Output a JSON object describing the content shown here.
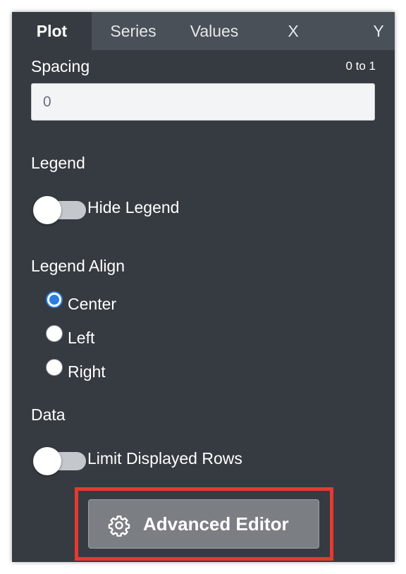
{
  "tabs": [
    {
      "label": "Plot",
      "active": true
    },
    {
      "label": "Series",
      "active": false
    },
    {
      "label": "Values",
      "active": false
    },
    {
      "label": "X",
      "active": false
    },
    {
      "label": "Y",
      "active": false
    }
  ],
  "spacing": {
    "label": "Spacing",
    "range_hint": "0 to 1",
    "value": "0"
  },
  "legend": {
    "section_label": "Legend",
    "toggle_label": "Hide Legend",
    "toggle_on": false
  },
  "legend_align": {
    "section_label": "Legend Align",
    "options": [
      {
        "label": "Center",
        "checked": true
      },
      {
        "label": "Left",
        "checked": false
      },
      {
        "label": "Right",
        "checked": false
      }
    ]
  },
  "data": {
    "section_label": "Data",
    "toggle_label": "Limit Displayed Rows",
    "toggle_on": false
  },
  "advanced_editor": {
    "label": "Advanced Editor",
    "icon": "gear-icon"
  },
  "colors": {
    "panel_bg": "#363b41",
    "tab_bar_bg": "#4a5058",
    "radio_accent": "#2a7de1",
    "highlight_border": "#e53a2f",
    "button_bg": "#7b7f83"
  }
}
